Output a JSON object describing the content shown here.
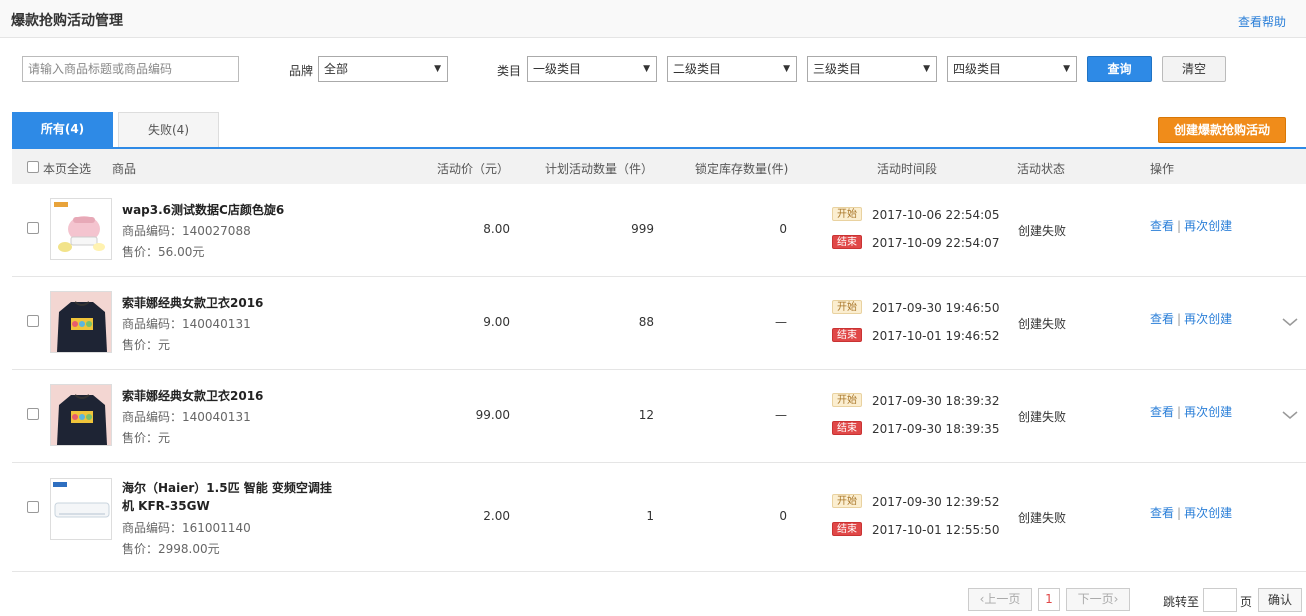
{
  "header": {
    "title": "爆款抢购活动管理",
    "help": "查看帮助"
  },
  "filters": {
    "search_placeholder": "请输入商品标题或商品编码",
    "brand_label": "品牌",
    "brand_value": "全部",
    "category_label": "类目",
    "cat1": "一级类目",
    "cat2": "二级类目",
    "cat3": "三级类目",
    "cat4": "四级类目",
    "query_button": "查询",
    "clear_button": "清空"
  },
  "tabs": [
    {
      "label": "所有(4)",
      "active": true
    },
    {
      "label": "失败(4)",
      "active": false
    }
  ],
  "create_button": "创建爆款抢购活动",
  "table": {
    "headers": {
      "select_all": "本页全选",
      "product": "商品",
      "price": "活动价（元）",
      "planned_qty": "计划活动数量（件）",
      "locked_stock": "锁定库存数量(件)",
      "period": "活动时间段",
      "status": "活动状态",
      "actions": "操作"
    },
    "start_tag": "开始",
    "end_tag": "结束",
    "rows": [
      {
        "name": "wap3.6测试数据C店颜色旋6",
        "code": "商品编码：140027088",
        "sale_price": "售价：56.00元",
        "price": "8.00",
        "planned_qty": "999",
        "locked": "0",
        "start": "2017-10-06 22:54:05",
        "end": "2017-10-09 22:54:07",
        "status": "创建失败",
        "view": "查看",
        "recreate": "再次创建",
        "thumb": "pink-appliance"
      },
      {
        "name": "索菲娜经典女款卫衣2016",
        "code": "商品编码：140040131",
        "sale_price": "售价：元",
        "price": "9.00",
        "planned_qty": "88",
        "locked": "—",
        "start": "2017-09-30 19:46:50",
        "end": "2017-10-01 19:46:52",
        "status": "创建失败",
        "view": "查看",
        "recreate": "再次创建",
        "thumb": "navy-sweater"
      },
      {
        "name": "索菲娜经典女款卫衣2016",
        "code": "商品编码：140040131",
        "sale_price": "售价：元",
        "price": "99.00",
        "planned_qty": "12",
        "locked": "—",
        "start": "2017-09-30 18:39:32",
        "end": "2017-09-30 18:39:35",
        "status": "创建失败",
        "view": "查看",
        "recreate": "再次创建",
        "thumb": "navy-sweater"
      },
      {
        "name": "海尔（Haier）1.5匹 智能 变频空调挂机 KFR-35GW",
        "code": "商品编码：161001140",
        "sale_price": "售价：2998.00元",
        "price": "2.00",
        "planned_qty": "1",
        "locked": "0",
        "start": "2017-09-30 12:39:52",
        "end": "2017-10-01 12:55:50",
        "status": "创建失败",
        "view": "查看",
        "recreate": "再次创建",
        "thumb": "air-conditioner"
      }
    ]
  },
  "pagination": {
    "prev": "上一页",
    "current": "1",
    "next": "下一页",
    "jump_to": "跳转至",
    "page_unit": "页",
    "confirm": "确认"
  },
  "colors": {
    "primary": "#2e8ae6",
    "accent": "#f08c1a",
    "danger": "#e04848"
  }
}
